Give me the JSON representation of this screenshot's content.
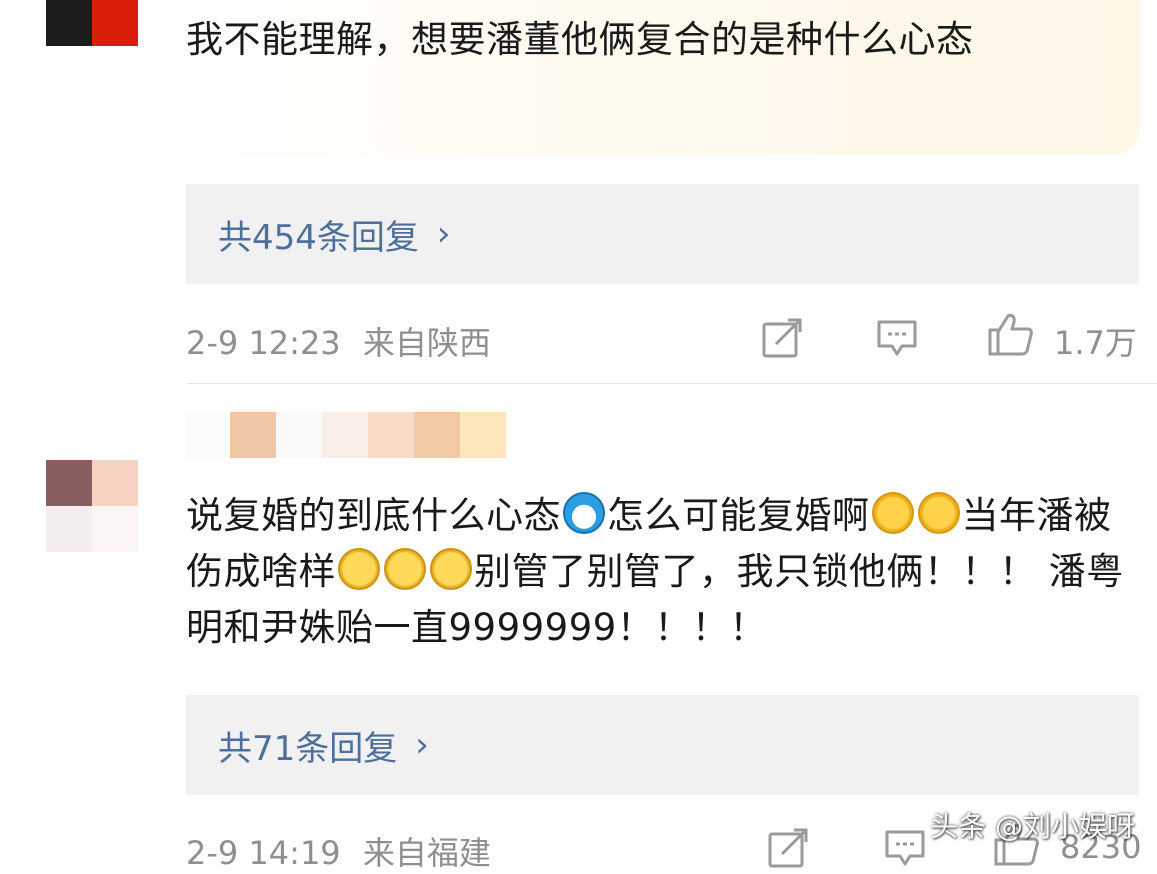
{
  "comment1": {
    "text": "我不能理解，想要潘董他俩复合的是种什么心态",
    "replies_label": "共454条回复",
    "chevron": "›",
    "timestamp": "2-9 12:23",
    "location": "来自陕西",
    "like_count": "1.7万"
  },
  "comment2": {
    "text_part1": "说复婚的到底什么心态",
    "text_part2": "怎么可能复婚啊",
    "text_part3": "当年潘被伤成啥样",
    "text_part4": "别管了别管了，我只锁他俩！！！ 潘粤明和尹姝贻一直9999999！！！！",
    "replies_label": "共71条回复",
    "chevron": "›",
    "timestamp": "2-9 14:19",
    "location": "来自福建",
    "like_count": "8230"
  },
  "watermark": "头条 @刘小娱呀",
  "icons": {
    "share": "share-icon",
    "comment": "comment-icon",
    "like": "thumbs-up-icon"
  },
  "colors": {
    "link": "#4d6f9a",
    "meta": "#8f8f8f",
    "reply_bg": "#f1f1f2"
  }
}
